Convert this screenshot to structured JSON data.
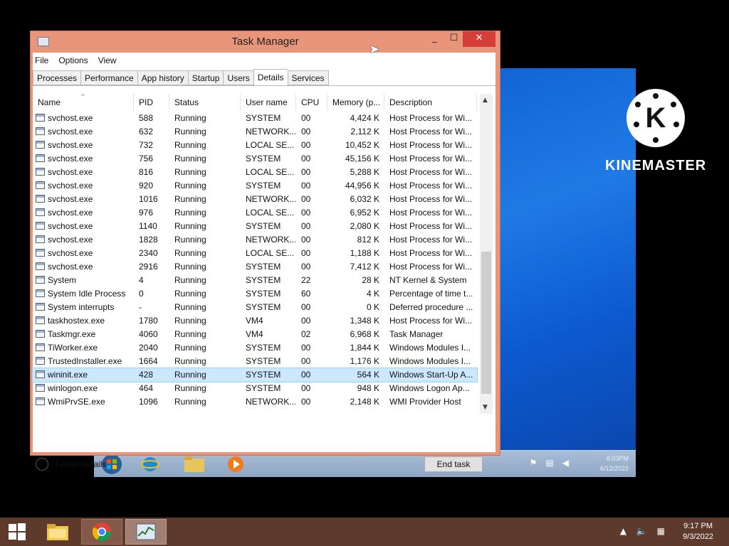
{
  "window": {
    "title": "Task Manager",
    "minimize": "_",
    "maximize": "☐",
    "close": "✕"
  },
  "menu": [
    "File",
    "Options",
    "View"
  ],
  "tabs": [
    "Processes",
    "Performance",
    "App history",
    "Startup",
    "Users",
    "Details",
    "Services"
  ],
  "active_tab": "Details",
  "table": {
    "columns": [
      "Name",
      "PID",
      "Status",
      "User name",
      "CPU",
      "Memory (p...",
      "Description"
    ],
    "sort_indicator": "˄",
    "rows": [
      [
        "svchost.exe",
        "588",
        "Running",
        "SYSTEM",
        "00",
        "4,424 K",
        "Host Process for Wi..."
      ],
      [
        "svchost.exe",
        "632",
        "Running",
        "NETWORK...",
        "00",
        "2,112 K",
        "Host Process for Wi..."
      ],
      [
        "svchost.exe",
        "732",
        "Running",
        "LOCAL SE...",
        "00",
        "10,452 K",
        "Host Process for Wi..."
      ],
      [
        "svchost.exe",
        "756",
        "Running",
        "SYSTEM",
        "00",
        "45,156 K",
        "Host Process for Wi..."
      ],
      [
        "svchost.exe",
        "816",
        "Running",
        "LOCAL SE...",
        "00",
        "5,288 K",
        "Host Process for Wi..."
      ],
      [
        "svchost.exe",
        "920",
        "Running",
        "SYSTEM",
        "00",
        "44,956 K",
        "Host Process for Wi..."
      ],
      [
        "svchost.exe",
        "1016",
        "Running",
        "NETWORK...",
        "00",
        "6,032 K",
        "Host Process for Wi..."
      ],
      [
        "svchost.exe",
        "976",
        "Running",
        "LOCAL SE...",
        "00",
        "6,952 K",
        "Host Process for Wi..."
      ],
      [
        "svchost.exe",
        "1140",
        "Running",
        "SYSTEM",
        "00",
        "2,080 K",
        "Host Process for Wi..."
      ],
      [
        "svchost.exe",
        "1828",
        "Running",
        "NETWORK...",
        "00",
        "812 K",
        "Host Process for Wi..."
      ],
      [
        "svchost.exe",
        "2340",
        "Running",
        "LOCAL SE...",
        "00",
        "1,188 K",
        "Host Process for Wi..."
      ],
      [
        "svchost.exe",
        "2916",
        "Running",
        "SYSTEM",
        "00",
        "7,412 K",
        "Host Process for Wi..."
      ],
      [
        "System",
        "4",
        "Running",
        "SYSTEM",
        "22",
        "28 K",
        "NT Kernel & System"
      ],
      [
        "System Idle Process",
        "0",
        "Running",
        "SYSTEM",
        "60",
        "4 K",
        "Percentage of time t..."
      ],
      [
        "System interrupts",
        "-",
        "Running",
        "SYSTEM",
        "00",
        "0 K",
        "Deferred procedure ..."
      ],
      [
        "taskhostex.exe",
        "1780",
        "Running",
        "VM4",
        "00",
        "1,348 K",
        "Host Process for Wi..."
      ],
      [
        "Taskmgr.exe",
        "4060",
        "Running",
        "VM4",
        "02",
        "6,968 K",
        "Task Manager"
      ],
      [
        "TiWorker.exe",
        "2040",
        "Running",
        "SYSTEM",
        "00",
        "1,844 K",
        "Windows Modules I..."
      ],
      [
        "TrustedInstaller.exe",
        "1664",
        "Running",
        "SYSTEM",
        "00",
        "1,176 K",
        "Windows Modules I..."
      ],
      [
        "wininit.exe",
        "428",
        "Running",
        "SYSTEM",
        "00",
        "564 K",
        "Windows Start-Up A..."
      ],
      [
        "winlogon.exe",
        "464",
        "Running",
        "SYSTEM",
        "00",
        "948 K",
        "Windows Logon Ap..."
      ],
      [
        "WmiPrvSE.exe",
        "1096",
        "Running",
        "NETWORK...",
        "00",
        "2,148 K",
        "WMI Provider Host"
      ]
    ],
    "selected_row": 19
  },
  "footer": {
    "fewer_details": "Fewer details",
    "end_task": "End task"
  },
  "watermark": {
    "logo_letter": "K",
    "text": "KINEMASTER"
  },
  "inner_taskbar": {
    "time": "6:03PM",
    "date": "6/12/2022"
  },
  "host_taskbar": {
    "time": "9:17 PM",
    "date": "9/3/2022"
  },
  "colors": {
    "window_frame": "#e8957a",
    "close_button": "#d43f3a",
    "selected_row": "#cce8ff",
    "host_taskbar": "#5e3a2c"
  }
}
